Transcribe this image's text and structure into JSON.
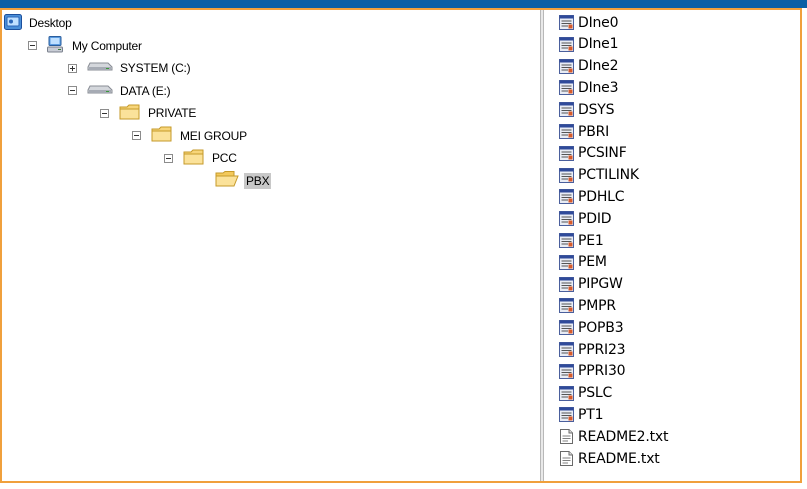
{
  "tree": [
    {
      "label": "Desktop",
      "icon": "desktop-icon",
      "expander": "none",
      "level": 0
    },
    {
      "label": "My Computer",
      "icon": "computer-icon",
      "expander": "minus",
      "level": 1
    },
    {
      "label": "SYSTEM (C:)",
      "icon": "drive-icon",
      "expander": "plus",
      "level": 2
    },
    {
      "label": "DATA (E:)",
      "icon": "drive-icon",
      "expander": "minus",
      "level": 2
    },
    {
      "label": "PRIVATE",
      "icon": "folder-icon",
      "expander": "minus",
      "level": 3
    },
    {
      "label": "MEI GROUP",
      "icon": "folder-icon",
      "expander": "minus",
      "level": 4
    },
    {
      "label": "PCC",
      "icon": "folder-icon",
      "expander": "minus",
      "level": 5
    },
    {
      "label": "PBX",
      "icon": "folder-open-icon",
      "expander": "none",
      "level": 6,
      "selected": true
    }
  ],
  "files": [
    {
      "label": "DIne0",
      "icon": "module-file-icon"
    },
    {
      "label": "DIne1",
      "icon": "module-file-icon"
    },
    {
      "label": "DIne2",
      "icon": "module-file-icon"
    },
    {
      "label": "DIne3",
      "icon": "module-file-icon"
    },
    {
      "label": "DSYS",
      "icon": "module-file-icon"
    },
    {
      "label": "PBRI",
      "icon": "module-file-icon"
    },
    {
      "label": "PCSINF",
      "icon": "module-file-icon"
    },
    {
      "label": "PCTILINK",
      "icon": "module-file-icon"
    },
    {
      "label": "PDHLC",
      "icon": "module-file-icon"
    },
    {
      "label": "PDID",
      "icon": "module-file-icon"
    },
    {
      "label": "PE1",
      "icon": "module-file-icon"
    },
    {
      "label": "PEM",
      "icon": "module-file-icon"
    },
    {
      "label": "PIPGW",
      "icon": "module-file-icon"
    },
    {
      "label": "PMPR",
      "icon": "module-file-icon"
    },
    {
      "label": "POPB3",
      "icon": "module-file-icon"
    },
    {
      "label": "PPRI23",
      "icon": "module-file-icon"
    },
    {
      "label": "PPRI30",
      "icon": "module-file-icon"
    },
    {
      "label": "PSLC",
      "icon": "module-file-icon"
    },
    {
      "label": "PT1",
      "icon": "module-file-icon"
    },
    {
      "label": "README2.txt",
      "icon": "text-file-icon"
    },
    {
      "label": "README.txt",
      "icon": "text-file-icon"
    }
  ],
  "colors": {
    "title_bar": "#0a5fa5",
    "frame_border": "#f0a03c",
    "folder": "#f7d57a",
    "selection": "#c8c8c8"
  }
}
